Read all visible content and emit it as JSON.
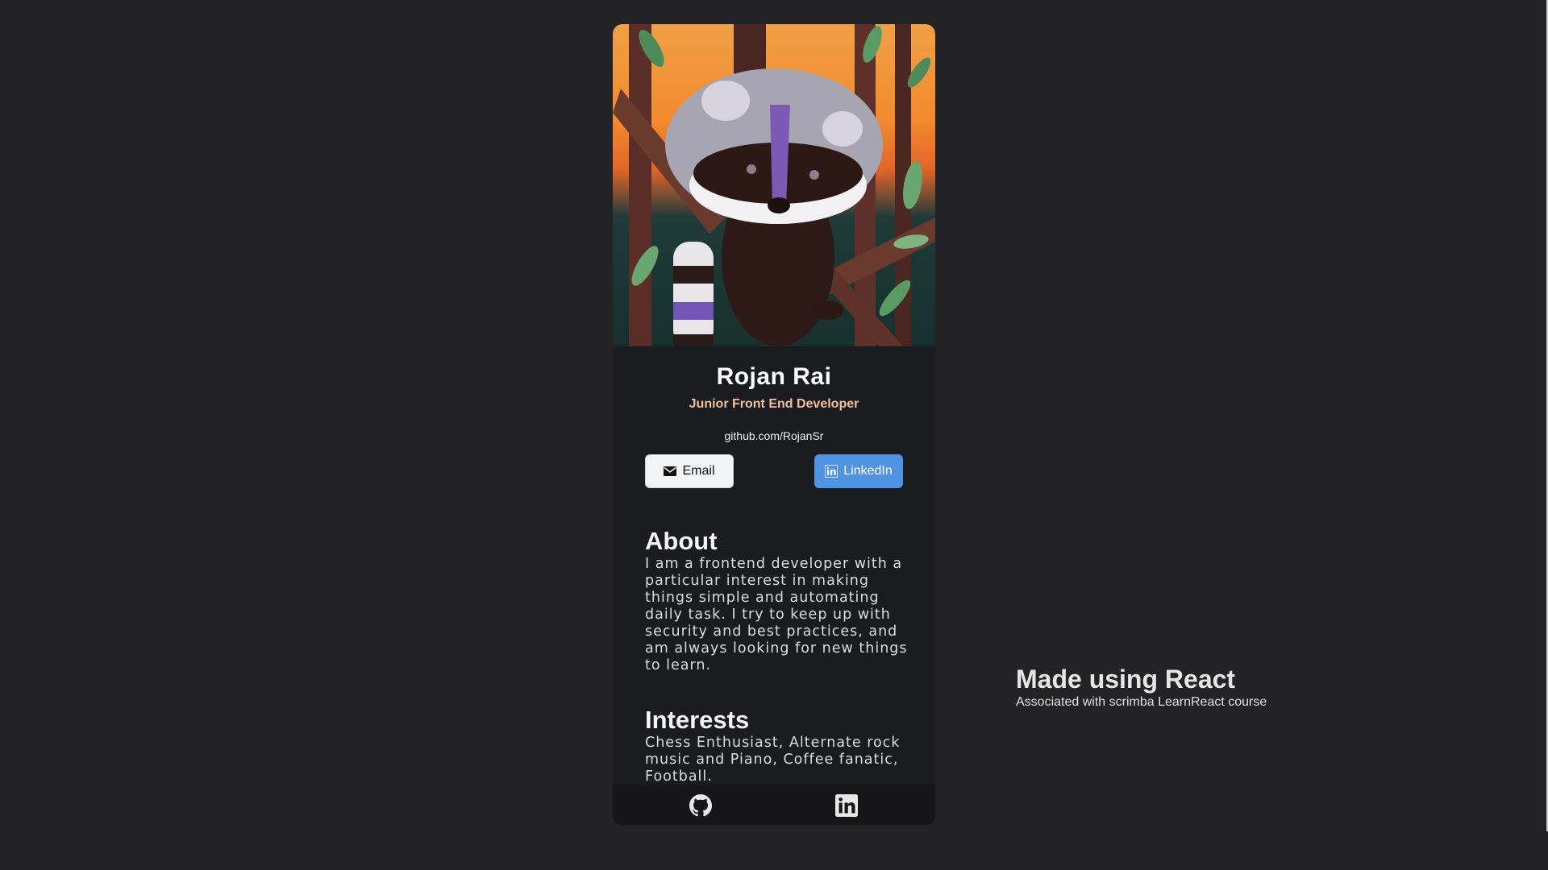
{
  "profile": {
    "name": "Rojan Rai",
    "title": "Junior Front End Developer",
    "website": "github.com/RojanSr",
    "image_icon": "raccoon-illustration"
  },
  "buttons": {
    "email_label": "Email",
    "email_icon": "envelope-icon",
    "linkedin_label": "LinkedIn",
    "linkedin_icon": "linkedin-icon",
    "linkedin_color": "#5093e2"
  },
  "about": {
    "heading": "About",
    "text": "I am a frontend developer with a particular interest in making things simple and automating daily task. I try to keep up with security and best practices, and am always looking for new things to learn."
  },
  "interests": {
    "heading": "Interests",
    "text": "Chess Enthusiast, Alternate rock music and Piano, Coffee fanatic, Football."
  },
  "footer": {
    "icons": [
      "github-icon",
      "linkedin-icon"
    ]
  },
  "side_note": {
    "heading": "Made using React",
    "subtext": "Associated with scrimba LearnReact course"
  },
  "colors": {
    "background": "#232325",
    "card": "#1a1b1e",
    "accent": "#f3bf99"
  }
}
